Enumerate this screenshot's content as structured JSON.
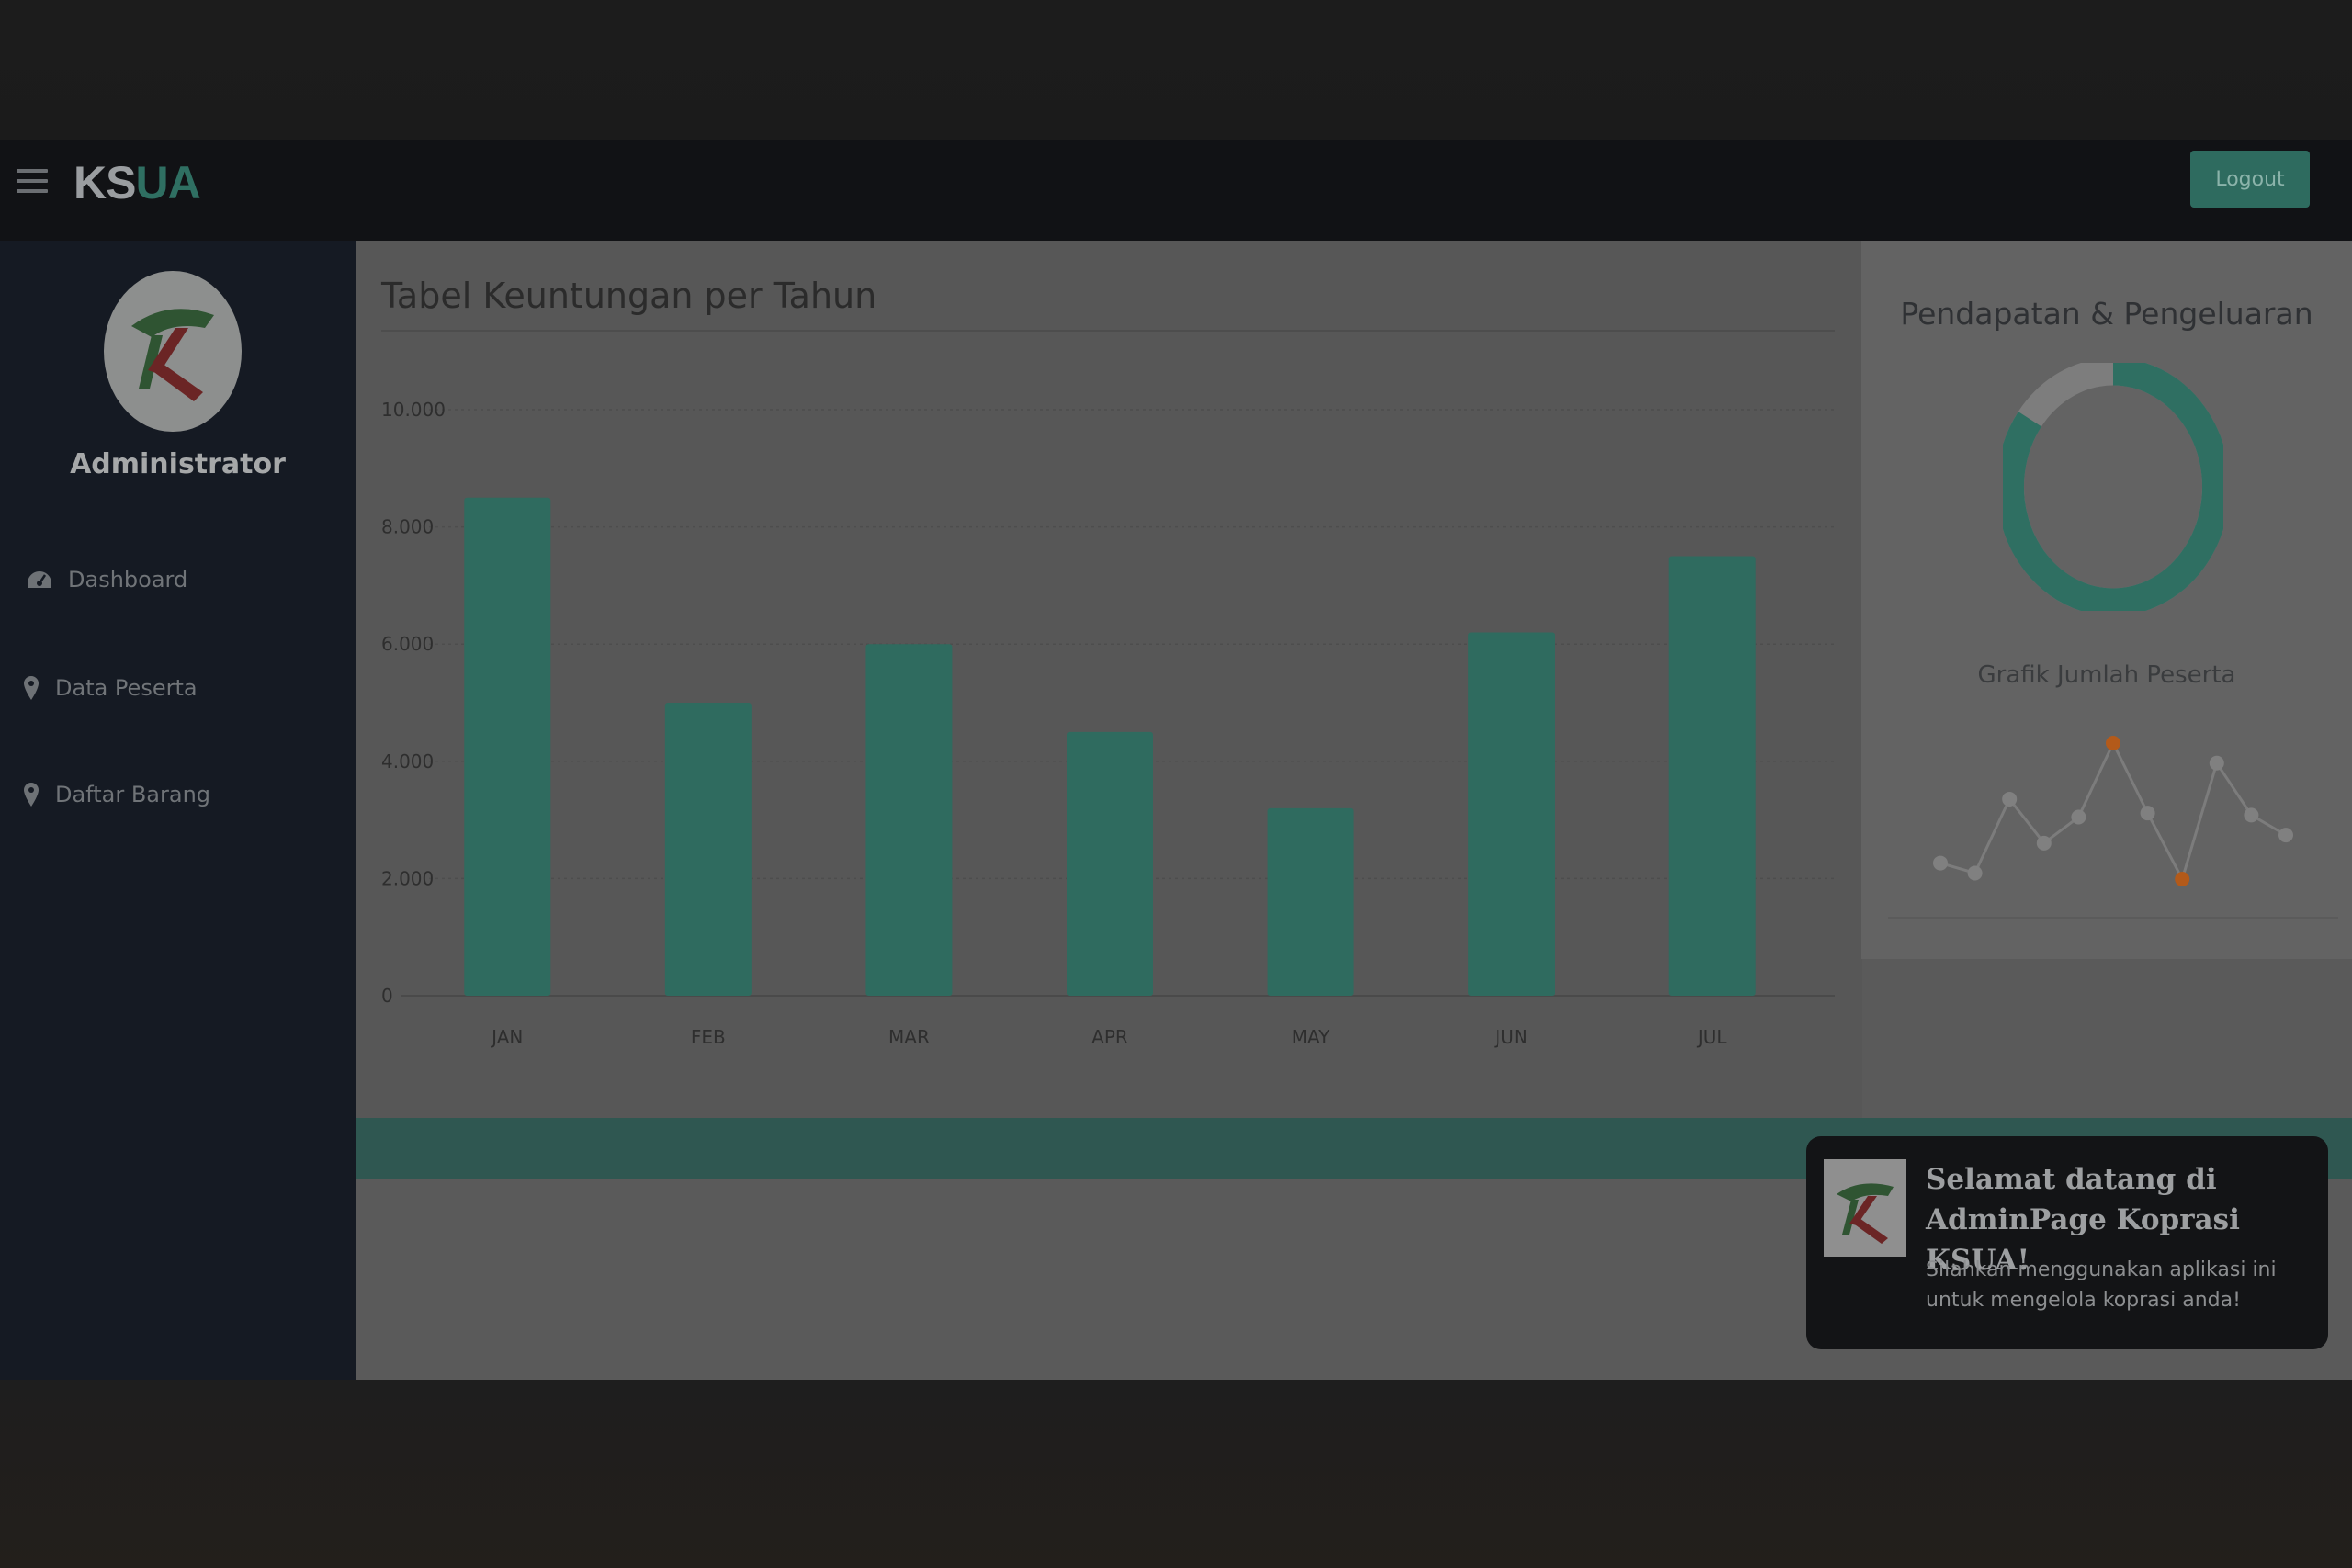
{
  "header": {
    "brand_part1": "KS",
    "brand_part2": "UA",
    "logout_label": "Logout"
  },
  "sidebar": {
    "user_name": "Administrator",
    "items": [
      {
        "label": "Dashboard",
        "icon": "dashboard-icon"
      },
      {
        "label": "Data Peserta",
        "icon": "map-pin-icon"
      },
      {
        "label": "Daftar Barang",
        "icon": "map-pin-icon"
      }
    ]
  },
  "main": {
    "profit_card_title": "Tabel Keuntungan per Tahun"
  },
  "right_panel": {
    "donut_title": "Pendapatan & Pengeluaran",
    "donut_fraction": 0.85,
    "line_title": "Grafik Jumlah Peserta"
  },
  "toast": {
    "title": "Selamat datang di AdminPage Koprasi KSUA!",
    "body": "Silahkan menggunakan aplikasi ini untuk mengelola koprasi anda!"
  },
  "colors": {
    "accent": "#2f6f62",
    "bar": "#2f6b5f",
    "sidebar": "#151a23",
    "topbar": "#111215",
    "highlight_point": "#b35a1a"
  },
  "chart_data": [
    {
      "type": "bar",
      "categories": [
        "JAN",
        "FEB",
        "MAR",
        "APR",
        "MAY",
        "JUN",
        "JUL"
      ],
      "values": [
        8500,
        5000,
        6000,
        4500,
        3200,
        6200,
        7500
      ],
      "ylim": [
        0,
        10000
      ],
      "yticks": [
        "0",
        "2.000",
        "4.000",
        "6.000",
        "8.000",
        "10.000"
      ],
      "grid": true
    },
    {
      "type": "pie",
      "values": [
        85,
        15
      ]
    },
    {
      "type": "line",
      "values": [
        2.0,
        1.5,
        5.2,
        3.0,
        4.3,
        8.0,
        4.5,
        1.2,
        7.0,
        4.4,
        3.4
      ],
      "highlighted_indices": [
        5,
        7
      ]
    }
  ]
}
